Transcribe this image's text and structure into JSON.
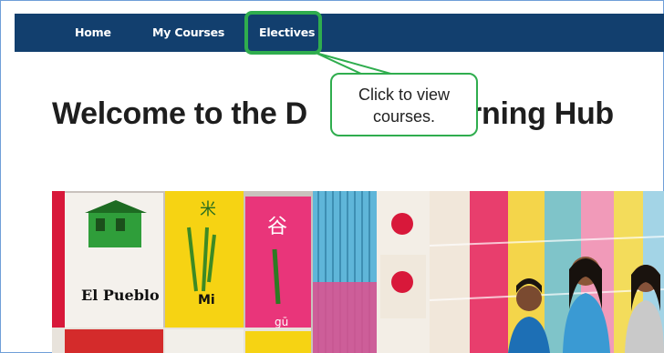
{
  "nav": {
    "items": [
      {
        "label": "Home"
      },
      {
        "label": "My Courses"
      },
      {
        "label": "Electives"
      }
    ]
  },
  "callout": {
    "line1": "Click to view",
    "line2": "courses."
  },
  "page": {
    "title_left": "Welcome to the D",
    "title_right": "earning Hub"
  },
  "hero": {
    "sign_el_pueblo": "El Pueblo",
    "sign_mi": "Mi",
    "sign_gu": "gū"
  },
  "colors": {
    "nav_bg": "#123f6e",
    "highlight": "#2fad4e"
  }
}
